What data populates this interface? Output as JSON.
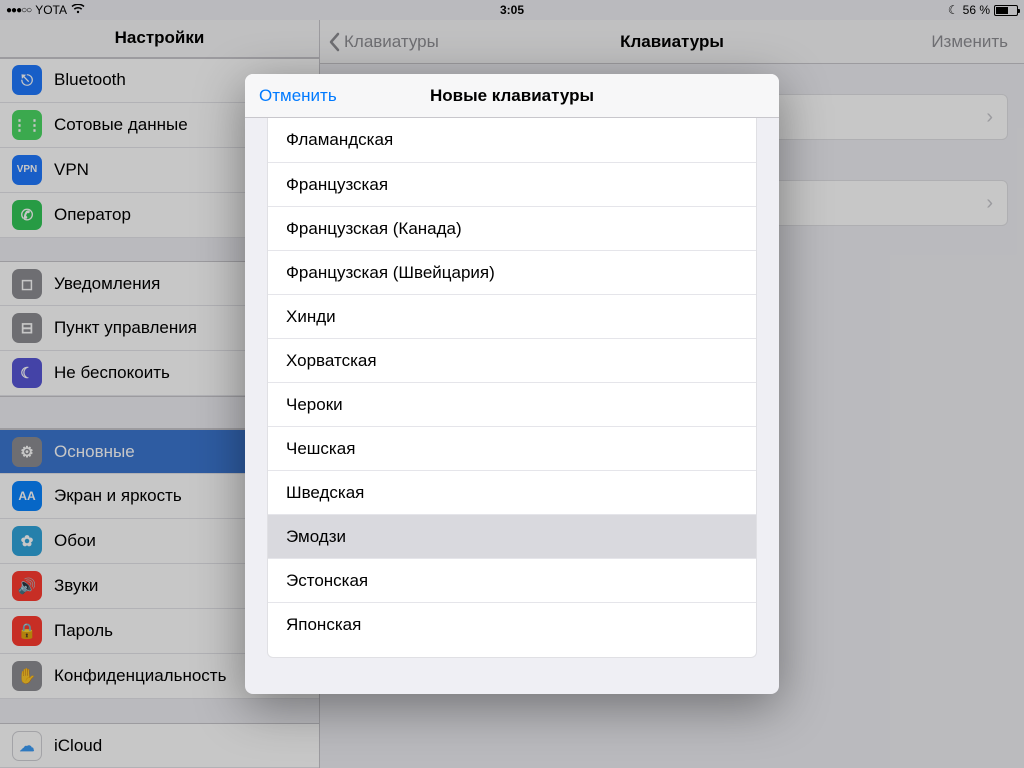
{
  "status": {
    "signal": "●●●○○",
    "carrier": "YOTA",
    "wifi": "􀙇",
    "time": "3:05",
    "moon": "☾",
    "battery_text": "56 %"
  },
  "sidebar": {
    "title": "Настройки",
    "items_top": [
      {
        "label": "Bluetooth",
        "icon_bg": "ic-blue",
        "glyph": "⎋"
      },
      {
        "label": "Сотовые данные",
        "icon_bg": "ic-green",
        "glyph": "⋮⋮"
      },
      {
        "label": "VPN",
        "icon_bg": "ic-blue",
        "glyph": "VPN"
      },
      {
        "label": "Оператор",
        "icon_bg": "ic-green2",
        "glyph": "✆"
      }
    ],
    "items_mid": [
      {
        "label": "Уведомления",
        "icon_bg": "ic-gray",
        "glyph": "◻"
      },
      {
        "label": "Пункт управления",
        "icon_bg": "ic-gray",
        "glyph": "⊟"
      },
      {
        "label": "Не беспокоить",
        "icon_bg": "ic-purple",
        "glyph": "☾"
      }
    ],
    "items_general": [
      {
        "label": "Основные",
        "icon_bg": "ic-gray",
        "glyph": "⚙",
        "selected": true
      },
      {
        "label": "Экран и яркость",
        "icon_bg": "ic-lblue",
        "glyph": "AA"
      },
      {
        "label": "Обои",
        "icon_bg": "ic-atom",
        "glyph": "✿"
      },
      {
        "label": "Звуки",
        "icon_bg": "ic-red",
        "glyph": "🔊"
      },
      {
        "label": "Пароль",
        "icon_bg": "ic-red",
        "glyph": "🔒"
      },
      {
        "label": "Конфиденциальность",
        "icon_bg": "ic-gray",
        "glyph": "✋"
      }
    ],
    "items_cloud": [
      {
        "label": "iCloud",
        "icon_bg": "ic-white",
        "glyph": "☁"
      }
    ]
  },
  "detail": {
    "back_label": "Клавиатуры",
    "title": "Клавиатуры",
    "edit": "Изменить"
  },
  "modal": {
    "cancel": "Отменить",
    "title": "Новые клавиатуры",
    "items": [
      {
        "label": "Фламандская"
      },
      {
        "label": "Французская"
      },
      {
        "label": "Французская (Канада)"
      },
      {
        "label": "Французская (Швейцария)"
      },
      {
        "label": "Хинди"
      },
      {
        "label": "Хорватская"
      },
      {
        "label": "Чероки"
      },
      {
        "label": "Чешская"
      },
      {
        "label": "Шведская"
      },
      {
        "label": "Эмодзи",
        "highlight": true
      },
      {
        "label": "Эстонская"
      },
      {
        "label": "Японская"
      }
    ]
  }
}
